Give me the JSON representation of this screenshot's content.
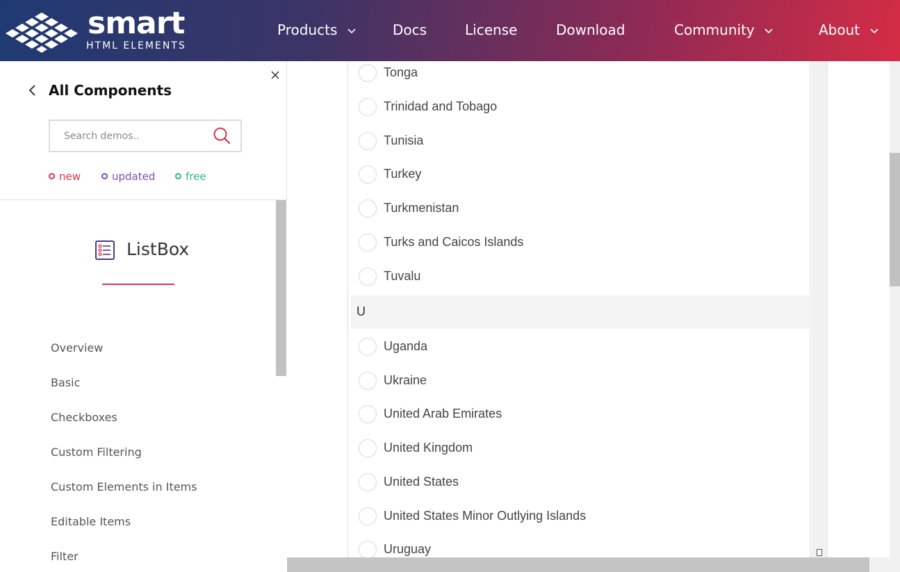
{
  "header": {
    "logo_word": "smart",
    "logo_sub": "HTML ELEMENTS",
    "nav": [
      {
        "label": "Products",
        "has_dropdown": true
      },
      {
        "label": "Docs",
        "has_dropdown": false
      },
      {
        "label": "License",
        "has_dropdown": false
      },
      {
        "label": "Download",
        "has_dropdown": false
      },
      {
        "label": "Community",
        "has_dropdown": true
      },
      {
        "label": "About",
        "has_dropdown": true
      }
    ]
  },
  "sidebar": {
    "back_label": "All Components",
    "search_placeholder": "Search demos..",
    "legend": {
      "new": "new",
      "updated": "updated",
      "free": "free"
    },
    "component_title": "ListBox",
    "demos": [
      "Overview",
      "Basic",
      "Checkboxes",
      "Custom Filtering",
      "Custom Elements in Items",
      "Editable Items",
      "Filter"
    ]
  },
  "listbox": {
    "items_before_group": [
      "Tonga",
      "Trinidad and Tobago",
      "Tunisia",
      "Turkey",
      "Turkmenistan",
      "Turks and Caicos Islands",
      "Tuvalu"
    ],
    "group_label": "U",
    "items_after_group": [
      "Uganda",
      "Ukraine",
      "United Arab Emirates",
      "United Kingdom",
      "United States",
      "United States Minor Outlying Islands",
      "Uruguay"
    ]
  },
  "colors": {
    "accent": "#e0314b",
    "updated": "#7a4fb0",
    "free": "#2eb87a",
    "header_start": "#1f3a73",
    "header_end": "#d42c45"
  }
}
